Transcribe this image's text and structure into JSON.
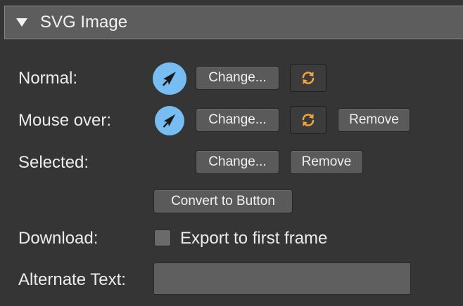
{
  "section": {
    "title": "SVG Image",
    "expanded": true,
    "disclosure_icon": "triangle-down-icon"
  },
  "rows": {
    "normal": {
      "label": "Normal:",
      "thumbnail_icon": "cursor-arrow-icon",
      "change_label": "Change...",
      "refresh_icon": "refresh-icon"
    },
    "mouse_over": {
      "label": "Mouse over:",
      "thumbnail_icon": "cursor-arrow-icon",
      "change_label": "Change...",
      "refresh_icon": "refresh-icon",
      "remove_label": "Remove"
    },
    "selected": {
      "label": "Selected:",
      "change_label": "Change...",
      "remove_label": "Remove"
    }
  },
  "convert_button_label": "Convert to Button",
  "download": {
    "label": "Download:",
    "checkbox_label": "Export to first frame",
    "checked": false
  },
  "alt_text": {
    "label": "Alternate Text:",
    "value": "",
    "placeholder": ""
  },
  "colors": {
    "background": "#353535",
    "header": "#5d5d5d",
    "thumbnail": "#78bdf2",
    "refresh_icon": "#f0a43a"
  }
}
